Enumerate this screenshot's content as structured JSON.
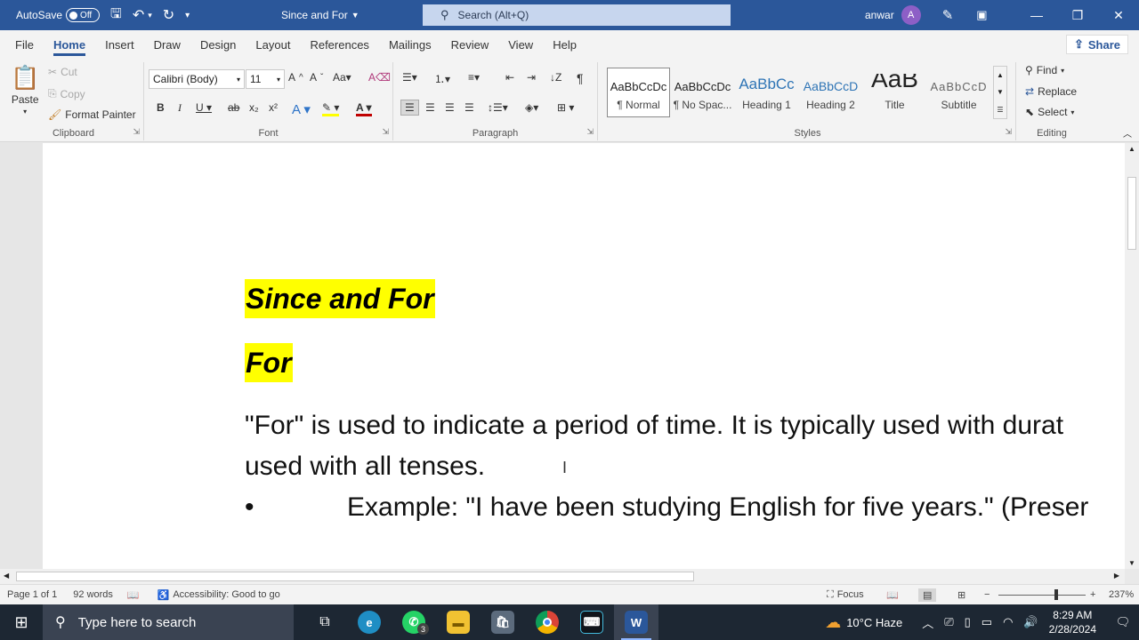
{
  "titlebar": {
    "autosave": "AutoSave",
    "toggle": "Off",
    "doc_title": "Since and For",
    "search_placeholder": "Search (Alt+Q)",
    "user": "anwar",
    "avatar": "A"
  },
  "menu": {
    "tabs": [
      "File",
      "Home",
      "Insert",
      "Draw",
      "Design",
      "Layout",
      "References",
      "Mailings",
      "Review",
      "View",
      "Help"
    ],
    "share": "Share"
  },
  "ribbon": {
    "clipboard": {
      "label": "Clipboard",
      "paste": "Paste",
      "cut": "Cut",
      "copy": "Copy",
      "format_painter": "Format Painter"
    },
    "font": {
      "label": "Font",
      "family": "Calibri (Body)",
      "size": "11"
    },
    "paragraph": {
      "label": "Paragraph"
    },
    "styles": {
      "label": "Styles",
      "items": [
        {
          "preview": "AaBbCcDc",
          "name": "¶ Normal"
        },
        {
          "preview": "AaBbCcDc",
          "name": "¶ No Spac..."
        },
        {
          "preview": "AaBbCc",
          "name": "Heading 1"
        },
        {
          "preview": "AaBbCcD",
          "name": "Heading 2"
        },
        {
          "preview": "AaB",
          "name": "Title"
        },
        {
          "preview": "AaBbCcD",
          "name": "Subtitle"
        }
      ]
    },
    "editing": {
      "label": "Editing",
      "find": "Find",
      "replace": "Replace",
      "select": "Select"
    }
  },
  "document": {
    "heading1": "Since and For",
    "heading2": "For",
    "para_line1": "\"For\" is used to indicate a period of time. It is typically used with durat",
    "para_line2": "used with all tenses.",
    "bullet": "•",
    "bullet_text": "Example: \"I have been studying English for five years.\" (Preser"
  },
  "status": {
    "page": "Page 1 of 1",
    "words": "92 words",
    "accessibility": "Accessibility: Good to go",
    "focus": "Focus",
    "zoom": "237%"
  },
  "taskbar": {
    "search": "Type here to search",
    "weather": "10°C  Haze",
    "time": "8:29 AM",
    "date": "2/28/2024",
    "whatsapp_badge": "3"
  }
}
